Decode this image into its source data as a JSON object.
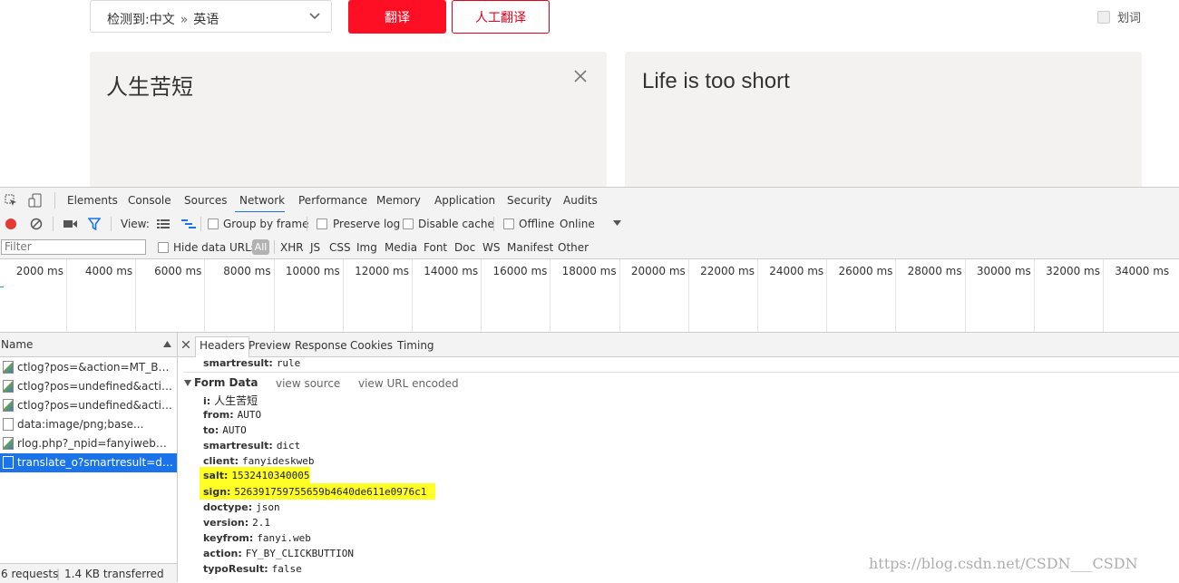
{
  "translator": {
    "lang_detect": "检测到:",
    "lang_from": "中文",
    "lang_sep": "»",
    "lang_to": "英语",
    "translate_btn": "翻译",
    "human_btn": "人工翻译",
    "huaci_label": "划词",
    "source_text": "人生苦短",
    "result_text": "Life is too short"
  },
  "devtools": {
    "tabs": [
      "Elements",
      "Console",
      "Sources",
      "Network",
      "Performance",
      "Memory",
      "Application",
      "Security",
      "Audits"
    ],
    "active_tab": "Network",
    "toolbar": {
      "view_label": "View:",
      "group_by_frame": "Group by frame",
      "preserve_log": "Preserve log",
      "disable_cache": "Disable cache",
      "offline": "Offline",
      "throttle": "Online"
    },
    "filter": {
      "placeholder": "Filter",
      "hide_data_urls": "Hide data URLs",
      "types": [
        "All",
        "XHR",
        "JS",
        "CSS",
        "Img",
        "Media",
        "Font",
        "Doc",
        "WS",
        "Manifest",
        "Other"
      ]
    },
    "timeline_ticks": [
      "2000 ms",
      "4000 ms",
      "6000 ms",
      "8000 ms",
      "10000 ms",
      "12000 ms",
      "14000 ms",
      "16000 ms",
      "18000 ms",
      "20000 ms",
      "22000 ms",
      "24000 ms",
      "26000 ms",
      "28000 ms",
      "30000 ms",
      "32000 ms",
      "34000 ms"
    ],
    "name_header": "Name",
    "requests": [
      {
        "name": "ctlog?pos=&action=MT_BUTTON...",
        "icon": "image-file-icon"
      },
      {
        "name": "ctlog?pos=undefined&action=...",
        "icon": "image-file-icon"
      },
      {
        "name": "ctlog?pos=undefined&action=...",
        "icon": "image-file-icon"
      },
      {
        "name": "data:image/png;base...",
        "icon": "document-file-icon"
      },
      {
        "name": "rlog.php?_npid=fanyiweb&_nc...",
        "icon": "image-file-icon"
      },
      {
        "name": "translate_o?smartresult=dict&...",
        "icon": "document-file-icon"
      }
    ],
    "status": {
      "requests": "6 requests",
      "sep": "|",
      "transferred": "1.4 KB transferred"
    },
    "detail_tabs": [
      "Headers",
      "Preview",
      "Response",
      "Cookies",
      "Timing"
    ],
    "active_detail_tab": "Headers",
    "prev_row": {
      "key": "smartresult:",
      "value": "rule"
    },
    "form_data": {
      "title": "Form Data",
      "view_source": "view source",
      "view_url_encoded": "view URL encoded",
      "rows": [
        {
          "key": "i:",
          "value": "人生苦短"
        },
        {
          "key": "from:",
          "value": "AUTO"
        },
        {
          "key": "to:",
          "value": "AUTO"
        },
        {
          "key": "smartresult:",
          "value": "dict"
        },
        {
          "key": "client:",
          "value": "fanyideskweb"
        },
        {
          "key": "salt:",
          "value": "1532410340005"
        },
        {
          "key": "sign:",
          "value": "526391759755659b4640de611e0976c1"
        },
        {
          "key": "doctype:",
          "value": "json"
        },
        {
          "key": "version:",
          "value": "2.1"
        },
        {
          "key": "keyfrom:",
          "value": "fanyi.web"
        },
        {
          "key": "action:",
          "value": "FY_BY_CLICKBUTTION"
        },
        {
          "key": "typoResult:",
          "value": "false"
        }
      ]
    }
  },
  "watermark": "https://blog.csdn.net/CSDN___CSDN",
  "colors": {
    "brand_red": "#ff0f23",
    "panel_bg": "#f3f2f1",
    "selected_row": "#1a73e8",
    "highlight": "#ffff26"
  }
}
